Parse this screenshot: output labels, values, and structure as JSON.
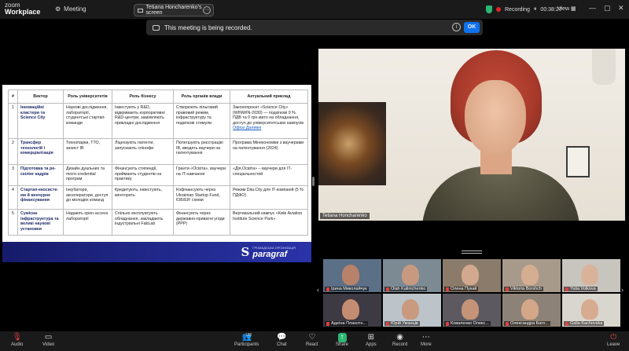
{
  "app": {
    "brand_line1": "zoom",
    "brand_line2": "Workplace",
    "meeting_label": "Meeting"
  },
  "share": {
    "screen_label": "Tetiana Honcharenko's screen"
  },
  "status": {
    "recording_label": "Recording",
    "timer": "00:38:27",
    "view_label": "View"
  },
  "banner": {
    "message": "This meeting is being recorded.",
    "ok_label": "OK"
  },
  "slide": {
    "headers": [
      "#",
      "Вектор",
      "Роль університетів",
      "Роль бізнесу",
      "Роль органів влади",
      "Актуальний приклад"
    ],
    "rows": [
      {
        "num": "1",
        "vector": "Інноваційні кластери та Science City",
        "uni": "Наукові дослідження, лабораторії, студентські стартап-команди",
        "biz": "Інвестують у R&D, відкривають корпоративні R&D-центри, замовляють прикладні дослідження",
        "gov": "Створюють пільговий правовий режим, інфраструктуру та податкові стимули",
        "example": "Законопроєкт «Science City» (WINWIN-2030) — податкові 0 % ПДВ та 0 грн мито на обладнання, доступ до університетських кампусів",
        "example_link": "Офіси Даливні"
      },
      {
        "num": "2",
        "vector": "Трансфер технологій і комерціалізація",
        "uni": "Технопарки, ТТО, захист IВ",
        "biz": "Ліцензують патенти, запускають спінофи",
        "gov": "Полегшують реєстрацію IВ, вводять ваучери на патентування",
        "example": "Програма Мінекономіки з ваучерами на патентування (2024)",
        "example_link": ""
      },
      {
        "num": "3",
        "vector": "Підготовка та ре­скілінг кадрів",
        "uni": "Дизайн дуальних та micro-credential програм",
        "biz": "Фінансують стипендії, приймають студентів на практику",
        "gov": "Гранти «Освіта», ваучери на IT-навчання",
        "example": "«Дія.Освіта» – ваучери для IT-спеціальностей",
        "example_link": ""
      },
      {
        "num": "4",
        "vector": "Стартап-екосисте­ми й венчурне фінансування",
        "uni": "Інкубатори, акселератори, доступ до молодих команд",
        "biz": "Кредитують, інвестують, менторять",
        "gov": "Кофінансують через Ukrainian Startup Fund, ЄІБ/EIF схеми",
        "example": "Режим Diia.City для IT-компаній (5 % ПДФО)",
        "example_link": ""
      },
      {
        "num": "5",
        "vector": "Сумісна інфраструктура та великі наукові установки",
        "uni": "Надають open-access лабораторії",
        "biz": "Спільно експлуатують обладнання, закладають індустріальні FabLab",
        "gov": "Фінансують через державно-приватні угоди (PPP)",
        "example": "Вертикальний кампус «Київ Aviation Institute Science Park»",
        "example_link": ""
      }
    ],
    "logo_small": "ГРОМАДСЬКА ОРГАНІЗАЦІЯ",
    "logo_big": "paragraf",
    "logo_mark": "S"
  },
  "speaker": {
    "name": "Tetiana Honcharenko"
  },
  "gallery": {
    "tiles": [
      {
        "name": "Ірина Миколайчук",
        "bg": "#5b6f86",
        "skin": "#b8826a"
      },
      {
        "name": "Olah Kalinichenko",
        "bg": "#7c8a94",
        "skin": "#c79a80"
      },
      {
        "name": "Олена Пукай",
        "bg": "#8b7b6a",
        "skin": "#d2a98e"
      },
      {
        "name": "Viktoria Borshch",
        "bg": "#a89a8a",
        "skin": "#d5ae92"
      },
      {
        "name": "Yulia Volkova",
        "bg": "#c8c4be",
        "skin": "#d8b39a"
      },
      {
        "name": "Адеїна Плахотн...",
        "bg": "#3d3a44",
        "skin": "#c48d72"
      },
      {
        "name": "Юрій Уманців",
        "bg": "#bcc4ca",
        "skin": "#c99a80"
      },
      {
        "name": "Коваленко Олекс...",
        "bg": "#5c5a60",
        "skin": "#c59378"
      },
      {
        "name": "Олександра Баго...",
        "bg": "#8d8277",
        "skin": "#d3a788"
      },
      {
        "name": "Galia Kachovska",
        "bg": "#d9d5cf",
        "skin": "#d6ab90"
      }
    ]
  },
  "toolbar": {
    "audio": "Audio",
    "video": "Video",
    "participants": "Participants",
    "participants_count": "100",
    "chat": "Chat",
    "react": "React",
    "share": "Share",
    "apps": "Apps",
    "record": "Record",
    "more": "More",
    "leave": "Leave"
  },
  "colors": {
    "accent": "#0e72ed",
    "recording": "#e02828",
    "share": "#2bb673",
    "slide_footer": "#1e2585"
  }
}
